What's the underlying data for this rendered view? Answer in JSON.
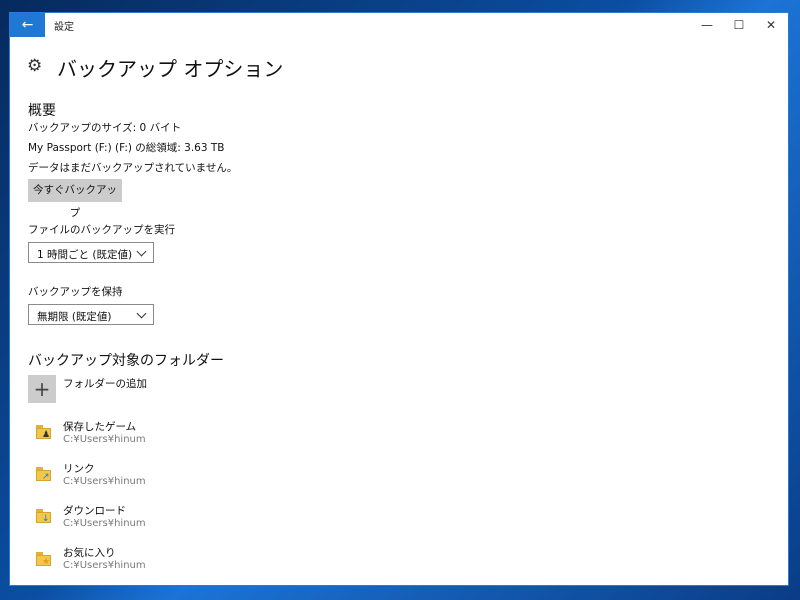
{
  "window": {
    "app_title": "設定",
    "back_glyph": "←",
    "minimize_glyph": "—",
    "maximize_glyph": "☐",
    "close_glyph": "✕"
  },
  "page": {
    "title": "バックアップ オプション",
    "icon": "gear-icon"
  },
  "overview": {
    "heading": "概要",
    "backup_size": "バックアップのサイズ: 0 バイト",
    "drive_total": "My Passport (F:) (F:) の総領域: 3.63 TB",
    "status": "データはまだバックアップされていません。",
    "backup_now_label": "今すぐバックアップ"
  },
  "frequency": {
    "label": "ファイルのバックアップを実行",
    "selected": "1 時間ごと (既定値)"
  },
  "retention": {
    "label": "バックアップを保持",
    "selected": "無期限 (既定値)"
  },
  "folders": {
    "heading": "バックアップ対象のフォルダー",
    "add_label": "フォルダーの追加",
    "add_glyph": "+",
    "items": [
      {
        "name": "保存したゲーム",
        "path": "C:¥Users¥hinum",
        "icon": "saved-games-folder-icon"
      },
      {
        "name": "リンク",
        "path": "C:¥Users¥hinum",
        "icon": "links-folder-icon"
      },
      {
        "name": "ダウンロード",
        "path": "C:¥Users¥hinum",
        "icon": "downloads-folder-icon"
      },
      {
        "name": "お気に入り",
        "path": "C:¥Users¥hinum",
        "icon": "favorites-folder-icon"
      }
    ]
  },
  "colors": {
    "accent": "#1e78d4",
    "button_gray": "#cccccc",
    "folder_yellow": "#f3c74a"
  }
}
